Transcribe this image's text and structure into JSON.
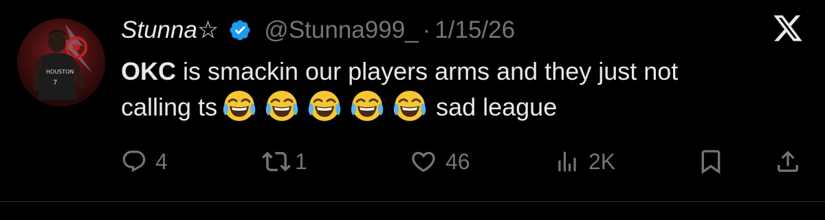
{
  "tweet": {
    "display_name": "Stunna☆",
    "handle": "@Stunna999_",
    "separator": "·",
    "date": "1/15/26",
    "text_bold": "OKC",
    "text_line1": " is smackin our players arms and they just not",
    "text_line2_start": "calling ts",
    "emojis": [
      "face-with-tears-of-joy",
      "face-with-tears-of-joy",
      "face-with-tears-of-joy",
      "face-with-tears-of-joy",
      "face-with-tears-of-joy"
    ],
    "text_line2_end": "sad league",
    "avatar_text": "HOUSTON",
    "avatar_number": "7"
  },
  "actions": {
    "replies": "4",
    "reposts": "1",
    "likes": "46",
    "views": "2K"
  },
  "icons": {
    "reply": "reply-icon",
    "repost": "repost-icon",
    "like": "heart-icon",
    "views": "views-icon",
    "bookmark": "bookmark-icon",
    "share": "share-icon",
    "brand": "x-logo-icon",
    "verified": "verified-badge-icon"
  },
  "colors": {
    "background": "#000000",
    "text": "#e7e9ea",
    "muted": "#71767b",
    "verified": "#1d9bf0"
  }
}
